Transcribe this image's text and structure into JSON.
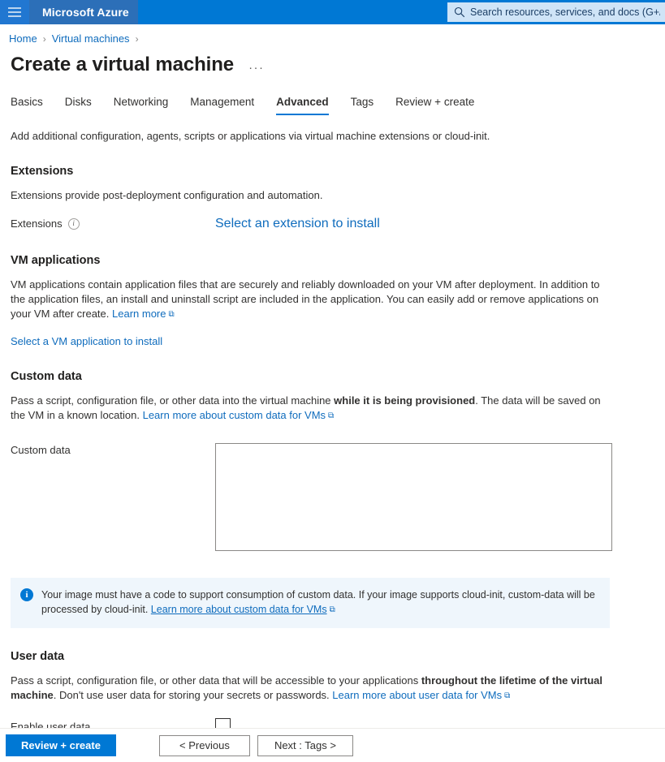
{
  "topbar": {
    "menu_icon": "hamburger-icon",
    "brand": "Microsoft Azure",
    "search_icon": "search-icon",
    "search_placeholder": "Search resources, services, and docs (G+/)",
    "background_color": "#0078d4",
    "search_background_color": "#cfe4f7"
  },
  "breadcrumb": {
    "items": [
      {
        "label": "Home"
      },
      {
        "label": "Virtual machines"
      }
    ],
    "separator": "›",
    "link_color": "#0f6cbd"
  },
  "page": {
    "title": "Create a virtual machine",
    "more_actions": "···"
  },
  "tabs": {
    "items": [
      {
        "label": "Basics",
        "active": false
      },
      {
        "label": "Disks",
        "active": false
      },
      {
        "label": "Networking",
        "active": false
      },
      {
        "label": "Management",
        "active": false
      },
      {
        "label": "Advanced",
        "active": true
      },
      {
        "label": "Tags",
        "active": false
      },
      {
        "label": "Review + create",
        "active": false
      }
    ],
    "active_underline_color": "#0078d4"
  },
  "main": {
    "intro": "Add additional configuration, agents, scripts or applications via virtual machine extensions or cloud-init.",
    "extensions": {
      "heading": "Extensions",
      "description": "Extensions provide post-deployment configuration and automation.",
      "field_label": "Extensions",
      "info_icon": "info-circle-icon",
      "select_link": "Select an extension to install"
    },
    "vm_applications": {
      "heading": "VM applications",
      "description_part1": "VM applications contain application files that are securely and reliably downloaded on your VM after deployment. In addition to the application files, an install and uninstall script are included in the application. You can easily add or remove applications on your VM after create. ",
      "learn_more": "Learn more",
      "external_link_icon": "⧉",
      "select_link": "Select a VM application to install"
    },
    "custom_data": {
      "heading": "Custom data",
      "description_part1": "Pass a script, configuration file, or other data into the virtual machine ",
      "description_bold": "while it is being provisioned",
      "description_part2": ". The data will be saved on the VM in a known location. ",
      "learn_more": "Learn more about custom data for VMs",
      "external_link_icon": "⧉",
      "field_label": "Custom data",
      "textarea_value": "",
      "banner": {
        "icon": "info-circle-filled-icon",
        "text_part1": "Your image must have a code to support consumption of custom data. If your image supports cloud-init, custom-data will be processed by cloud-init. ",
        "link": "Learn more about custom data for VMs",
        "external_link_icon": "⧉",
        "background_color": "#eff6fc",
        "icon_color": "#0078d4"
      }
    },
    "user_data": {
      "heading": "User data",
      "description_part1": "Pass a script, configuration file, or other data that will be accessible to your applications ",
      "description_bold": "throughout the lifetime of the virtual machine",
      "description_part2": ". Don't use user data for storing your secrets or passwords. ",
      "learn_more": "Learn more about user data for VMs",
      "external_link_icon": "⧉",
      "enable_label": "Enable user data",
      "enable_checked": false
    }
  },
  "footer": {
    "review_create": "Review + create",
    "previous": "< Previous",
    "next": "Next : Tags >",
    "primary_color": "#0078d4"
  }
}
